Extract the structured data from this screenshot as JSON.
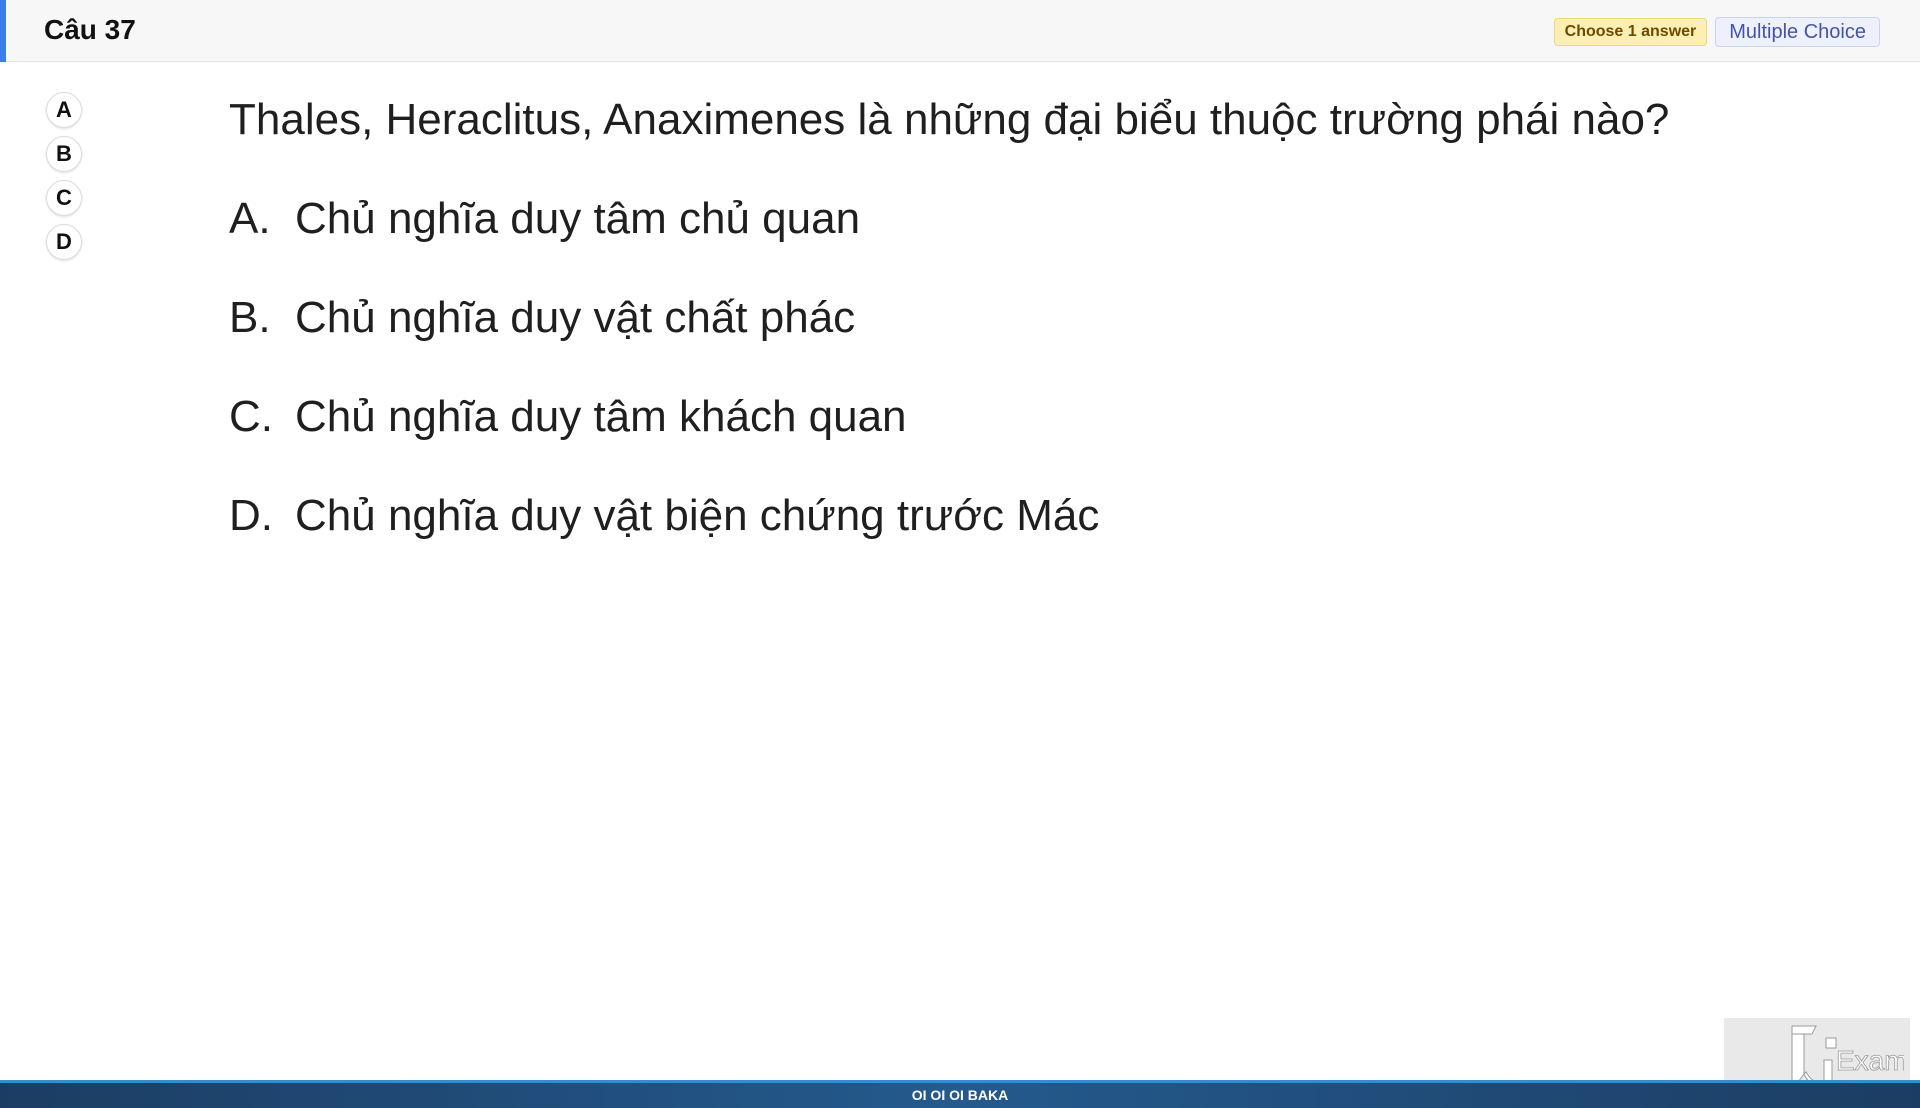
{
  "header": {
    "question_title": "Câu 37",
    "choose_badge": "Choose 1 answer",
    "type_badge": "Multiple Choice",
    "accent_color": "#3b7de6"
  },
  "answer_selector": [
    "A",
    "B",
    "C",
    "D"
  ],
  "question": {
    "text": "Thales, Heraclitus, Anaximenes là những đại biểu thuộc trường phái nào?",
    "options": [
      {
        "letter": "A.",
        "text": "Chủ nghĩa duy tâm chủ quan"
      },
      {
        "letter": "B.",
        "text": "Chủ nghĩa duy vật chất phác"
      },
      {
        "letter": "C.",
        "text": "Chủ nghĩa duy tâm khách quan"
      },
      {
        "letter": "D.",
        "text": "Chủ nghĩa duy vật biện chứng trước Mác"
      }
    ]
  },
  "footer": {
    "text": "OI OI OI BAKA"
  },
  "logo": {
    "text": "Exam",
    "icon": "fu-exam-logo"
  }
}
